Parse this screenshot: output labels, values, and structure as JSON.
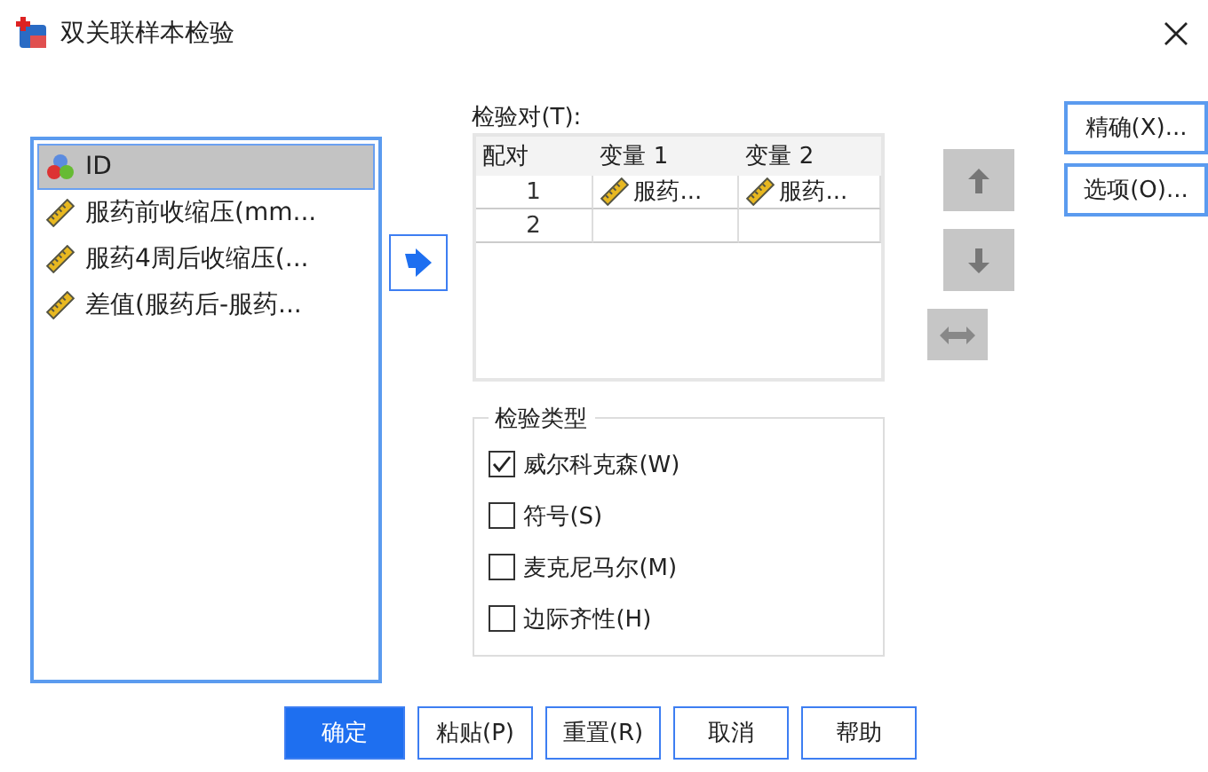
{
  "window": {
    "title": "双关联样本检验"
  },
  "variables": [
    {
      "name": "ID",
      "kind": "nominal",
      "selected": true
    },
    {
      "name": "服药前收缩压(mm...",
      "kind": "scale",
      "selected": false
    },
    {
      "name": "服药4周后收缩压(...",
      "kind": "scale",
      "selected": false
    },
    {
      "name": "差值(服药后-服药...",
      "kind": "scale",
      "selected": false
    }
  ],
  "pairs": {
    "label": "检验对(T):",
    "columns": [
      "配对",
      "变量 1",
      "变量 2"
    ],
    "rows": [
      [
        "1",
        "服药...",
        "服药..."
      ],
      [
        "2",
        "",
        ""
      ]
    ]
  },
  "test_type": {
    "title": "检验类型",
    "options": [
      {
        "label": "威尔科克森(W)",
        "checked": true
      },
      {
        "label": "符号(S)",
        "checked": false
      },
      {
        "label": "麦克尼马尔(M)",
        "checked": false
      },
      {
        "label": "边际齐性(H)",
        "checked": false
      }
    ]
  },
  "side_buttons": [
    "精确(X)...",
    "选项(O)..."
  ],
  "buttons": [
    {
      "label": "确定",
      "primary": true
    },
    {
      "label": "粘贴(P)",
      "primary": false
    },
    {
      "label": "重置(R)",
      "primary": false
    },
    {
      "label": "取消",
      "primary": false
    },
    {
      "label": "帮助",
      "primary": false
    }
  ]
}
